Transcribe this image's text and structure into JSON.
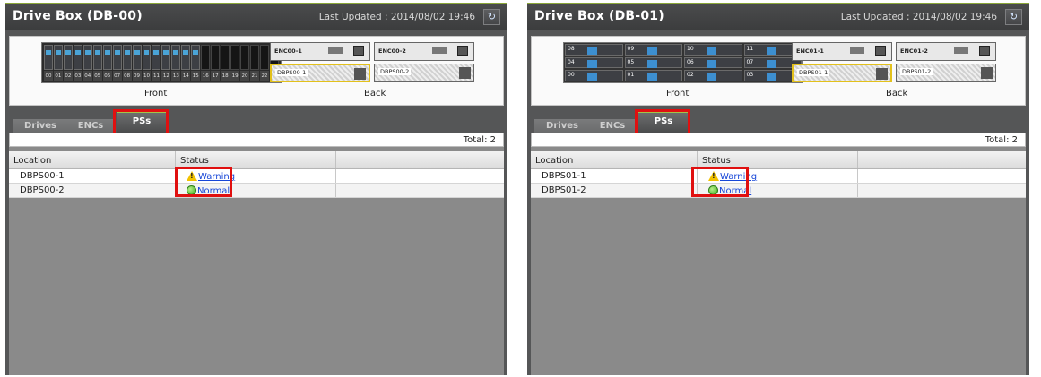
{
  "panels": [
    {
      "title": "Drive Box (DB-00)",
      "last_updated": "Last Updated : 2014/08/02 19:46",
      "refresh_icon": "refresh-icon",
      "front_label": "Front",
      "back_label": "Back",
      "bay_numbers": [
        "00",
        "01",
        "02",
        "03",
        "04",
        "05",
        "06",
        "07",
        "08",
        "09",
        "10",
        "11",
        "12",
        "13",
        "14",
        "15",
        "16",
        "17",
        "18",
        "19",
        "20",
        "21",
        "22",
        "23"
      ],
      "enclosures": [
        "ENC00-1",
        "ENC00-2"
      ],
      "power_supplies": [
        "DBPS00-1",
        "DBPS00-2"
      ],
      "tabs": [
        "Drives",
        "ENCs",
        "PSs"
      ],
      "active_tab": "PSs",
      "total": "Total: 2",
      "columns": [
        "Location",
        "Status",
        ""
      ],
      "rows": [
        {
          "location": "DBPS00-1",
          "status": "Warning",
          "status_icon": "warning-icon"
        },
        {
          "location": "DBPS00-2",
          "status": "Normal",
          "status_icon": "normal-icon"
        }
      ]
    },
    {
      "title": "Drive Box (DB-01)",
      "last_updated": "Last Updated : 2014/08/02 19:46",
      "refresh_icon": "refresh-icon",
      "front_label": "Front",
      "back_label": "Back",
      "bay_numbers": [
        "08",
        "09",
        "10",
        "11",
        "04",
        "05",
        "06",
        "07",
        "00",
        "01",
        "02",
        "03"
      ],
      "enclosures": [
        "ENC01-1",
        "ENC01-2"
      ],
      "power_supplies": [
        "DBPS01-1",
        "DBPS01-2"
      ],
      "tabs": [
        "Drives",
        "ENCs",
        "PSs"
      ],
      "active_tab": "PSs",
      "total": "Total: 2",
      "columns": [
        "Location",
        "Status",
        ""
      ],
      "rows": [
        {
          "location": "DBPS01-1",
          "status": "Warning",
          "status_icon": "warning-icon"
        },
        {
          "location": "DBPS01-2",
          "status": "Normal",
          "status_icon": "normal-icon"
        }
      ]
    }
  ],
  "colors": {
    "panel_bg": "#555657",
    "accent_green": "#8aa638",
    "highlight_red": "#e01010",
    "link_blue": "#1646d8",
    "warning_yellow": "#f2c200",
    "normal_green": "#37a51a"
  }
}
